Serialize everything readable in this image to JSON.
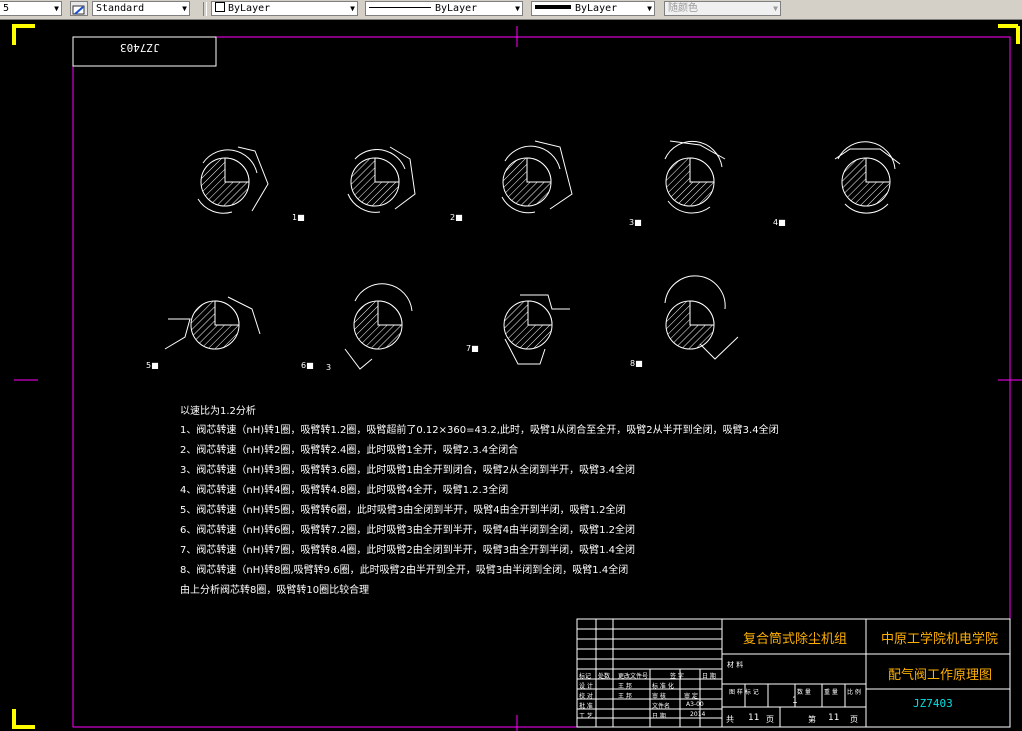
{
  "toolbar": {
    "partial_left_value": "5",
    "text_style": "Standard",
    "layer": "ByLayer",
    "linetype": "ByLayer",
    "lineweight": "ByLayer",
    "plot_style": "随颜色"
  },
  "drawing": {
    "mirrored_code": "JZ7403",
    "figure_labels": [
      "1",
      "2",
      "3",
      "4",
      "5",
      "6",
      "7",
      "8"
    ],
    "figure_label_suffix": "■",
    "stray_label": "3"
  },
  "notes": [
    "以速比为1.2分析",
    "1、阀芯转速（nH)转1圈，吸臂转1.2圈，吸臂超前了0.12×360=43.2,此时，吸臂1从闭合至全开，吸臂2从半开到全闭，吸臂3.4全闭",
    "2、阀芯转速（nH)转2圈，吸臂转2.4圈，此时吸臂1全开，吸臂2.3.4全闭合",
    "3、阀芯转速（nH)转3圈，吸臂转3.6圈，此时吸臂1由全开到闭合，吸臂2从全闭到半开，吸臂3.4全闭",
    "4、阀芯转速（nH)转4圈，吸臂转4.8圈，此时吸臂4全开，吸臂1.2.3全闭",
    "5、阀芯转速（nH)转5圈，吸臂转6圈，此时吸臂3由全闭到半开，吸臂4由全开到半闭，吸臂1.2全闭",
    "6、阀芯转速（nH)转6圈，吸臂转7.2圈，此时吸臂3由全开到半开，吸臂4由半闭到全闭，吸臂1.2全闭",
    "7、阀芯转速（nH)转7圈，吸臂转8.4圈，此时吸臂2由全闭到半开，吸臂3由全开到半闭，吸臂1.4全闭",
    "8、阀芯转速（nH)转8圈,吸臂转9.6圈，此时吸臂2由半开到全开，吸臂3由半闭到全闭，吸臂1.4全闭",
    "由上分析阀芯转8圈，吸臂转10圈比较合理"
  ],
  "title_block": {
    "product_name": "复合筒式除尘机组",
    "institution": "中原工学院机电学院",
    "drawing_title": "配气阀工作原理图",
    "drawing_code": "JZ7403",
    "material_label": "材 料",
    "header_row": [
      "标记",
      "处数",
      "更改文件号",
      "签 字",
      "日 期"
    ],
    "design_label": "设 计",
    "designer": "王 邦",
    "std_label": "标 准 化",
    "check_label": "校 对",
    "checker": "王 邦",
    "review_label": "审 核",
    "process_label": "审 定",
    "approve_label": "批 准",
    "craft_label": "工 艺",
    "date_label": "日 期",
    "date_value": "2014",
    "file_label": "文件名",
    "file_value": "A3-00",
    "stage_headers": [
      "图 样 标 记",
      "数 量",
      "重 量",
      "比 例"
    ],
    "quantity": "1",
    "sheet_total_label": "共",
    "sheet_total": "11",
    "sheet_unit": "页",
    "sheet_no_label": "第",
    "sheet_no": "11",
    "sheet_no_unit": "页"
  }
}
